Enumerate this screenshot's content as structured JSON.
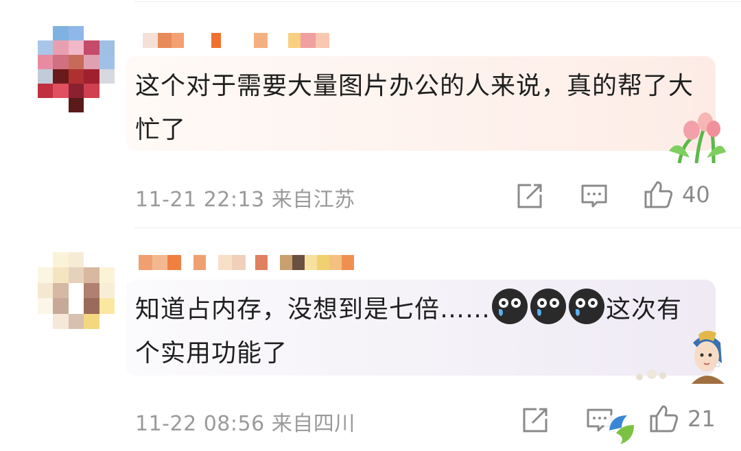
{
  "comments": [
    {
      "text": "这个对于需要大量图片办公的人来说，真的帮了大忙了",
      "meta": "11-21 22:13 来自江苏",
      "like_count": "40",
      "bubble_color": "#fdeee9"
    },
    {
      "text": "知道占内存，没想到是七倍……",
      "text_tail": "这次有个实用功能了",
      "meta": "11-22 08:56 来自四川",
      "like_count": "21",
      "bubble_color": "#f2eff5"
    }
  ],
  "icons": {
    "share": "share-icon",
    "comment": "comment-icon",
    "like": "thumbs-up-icon",
    "emoji": "crying-face-emoji"
  }
}
